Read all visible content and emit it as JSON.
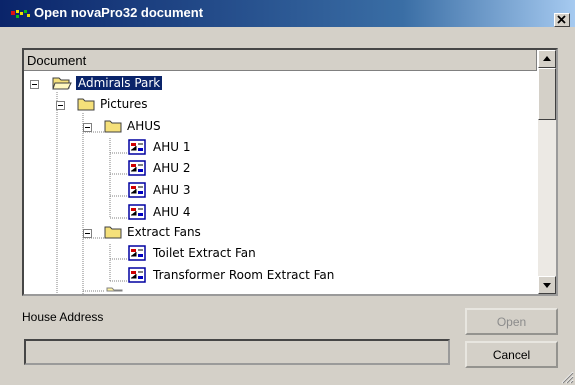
{
  "window": {
    "title": "Open novaPro32 document",
    "icon": "novapro-app-icon",
    "close_icon": "close-x-icon"
  },
  "tree": {
    "header": "Document",
    "nodes": [
      {
        "label": "Admirals Park",
        "icon": "folder-open-icon",
        "expander": "minus",
        "selected": true
      },
      {
        "label": "Pictures",
        "icon": "folder-icon",
        "expander": "minus",
        "selected": false
      },
      {
        "label": "AHUS",
        "icon": "folder-icon",
        "expander": "minus",
        "selected": false
      },
      {
        "label": "AHU 1",
        "icon": "document-icon",
        "expander": "",
        "selected": false
      },
      {
        "label": "AHU 2",
        "icon": "document-icon",
        "expander": "",
        "selected": false
      },
      {
        "label": "AHU 3",
        "icon": "document-icon",
        "expander": "",
        "selected": false
      },
      {
        "label": "AHU 4",
        "icon": "document-icon",
        "expander": "",
        "selected": false
      },
      {
        "label": "Extract Fans",
        "icon": "folder-icon",
        "expander": "minus",
        "selected": false
      },
      {
        "label": "Toilet Extract Fan",
        "icon": "document-icon",
        "expander": "",
        "selected": false
      },
      {
        "label": "Transformer Room Extract Fan",
        "icon": "document-icon",
        "expander": "",
        "selected": false
      }
    ]
  },
  "house_address": {
    "label": "House Address",
    "value": ""
  },
  "buttons": {
    "open": "Open",
    "cancel": "Cancel",
    "open_enabled": false
  },
  "colors": {
    "titlebar": "#0a246a",
    "selection": "#0a246a",
    "face": "#d4d0c8"
  }
}
